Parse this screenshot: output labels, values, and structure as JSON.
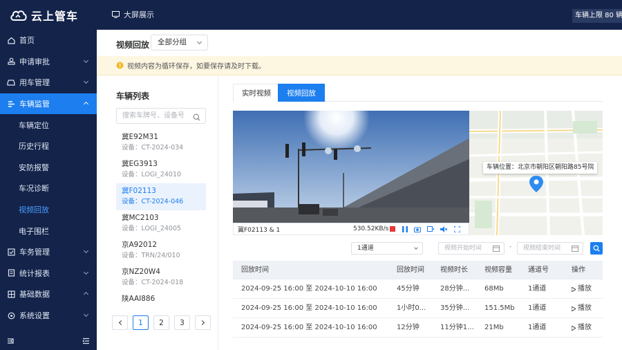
{
  "app": {
    "name": "云上管车",
    "big_screen": "大屏展示",
    "top_notice": "车辆上限 80 辆，"
  },
  "sidebar": {
    "items": [
      {
        "label": "首页",
        "icon": "home-icon"
      },
      {
        "label": "申请审批",
        "icon": "approval-icon"
      },
      {
        "label": "用车管理",
        "icon": "car-icon"
      },
      {
        "label": "车辆监管",
        "icon": "monitor-icon"
      },
      {
        "label": "车务管理",
        "icon": "task-icon"
      },
      {
        "label": "统计报表",
        "icon": "report-icon"
      },
      {
        "label": "基础数据",
        "icon": "data-icon"
      },
      {
        "label": "系统设置",
        "icon": "settings-icon"
      }
    ],
    "sub_items": [
      "车辆定位",
      "历史行程",
      "安防报警",
      "车况诊断",
      "视频回放",
      "电子围栏"
    ]
  },
  "header": {
    "title": "视频回放",
    "group_select": "全部分组"
  },
  "warning": "视频内容为循环保存，如要保存请及时下载。",
  "vehicle_list": {
    "title": "车辆列表",
    "search_placeholder": "搜索车牌号、设备号",
    "vehicles": [
      {
        "plate": "冀E92M31",
        "device": "设备：CT-2024-034"
      },
      {
        "plate": "冀EG3913",
        "device": "设备：LOGI_24010"
      },
      {
        "plate": "冀F02113",
        "device": "设备：CT-2024-046"
      },
      {
        "plate": "冀MC2103",
        "device": "设备：LOGI_24005"
      },
      {
        "plate": "京A92012",
        "device": "设备：TRN/24/010"
      },
      {
        "plate": "京NZ20W4",
        "device": "设备：CT-2024-018"
      },
      {
        "plate": "陕AAI886",
        "device": ""
      }
    ],
    "pages": [
      "1",
      "2",
      "3"
    ]
  },
  "tabs": [
    "实时视频",
    "视频回放"
  ],
  "player": {
    "channel_text": "冀F02113 & 1",
    "speed": "530.52KB/s"
  },
  "map": {
    "location_label": "车辆位置：北京市朝阳区朝阳路85号院"
  },
  "filters": {
    "channel": "1通道",
    "start_placeholder": "视频开始时间",
    "end_placeholder": "视频结束时间",
    "separator": "-"
  },
  "table": {
    "headers": [
      "回放时间",
      "回放时间",
      "视频时长",
      "视频容量",
      "通道号",
      "操作"
    ],
    "rows": [
      {
        "range": "2024-09-25 16:00 至 2024-10-10 16:00",
        "time": "45分钟",
        "duration": "28分钟...",
        "size": "68Mb",
        "channel": "1通道",
        "action": "播放"
      },
      {
        "range": "2024-09-25 16:00 至 2024-10-10 16:00",
        "time": "1小时0...",
        "duration": "35分钟...",
        "size": "151.5Mb",
        "channel": "1通道",
        "action": "播放"
      },
      {
        "range": "2024-09-25 16:00 至 2024-10-10 16:00",
        "time": "12分钟",
        "duration": "11分钟1...",
        "size": "21Mb",
        "channel": "1通道",
        "action": "播放"
      }
    ]
  },
  "colors": {
    "sidebar_bg": "#13234a",
    "accent": "#1c7eef",
    "warning_bg": "#fdf6e1"
  }
}
